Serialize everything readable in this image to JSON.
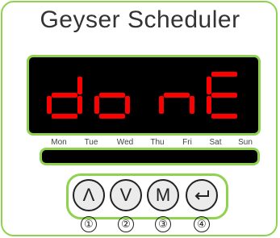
{
  "title": "Geyser Scheduler",
  "display": {
    "text": "donE",
    "segment_color": "#ff0000",
    "background": "#000000"
  },
  "days": [
    "Mon",
    "Tue",
    "Wed",
    "Thu",
    "Fri",
    "Sat",
    "Sun"
  ],
  "buttons": [
    {
      "label": "Λ",
      "icon": "chevron-up-icon",
      "number": "①"
    },
    {
      "label": "V",
      "icon": "chevron-down-icon",
      "number": "②"
    },
    {
      "label": "M",
      "icon": "mode-icon",
      "number": "③"
    },
    {
      "label": "",
      "icon": "enter-icon",
      "number": "④"
    }
  ],
  "colors": {
    "accent": "#8fd24f",
    "button_fill": "#ebebeb",
    "text": "#333333"
  }
}
